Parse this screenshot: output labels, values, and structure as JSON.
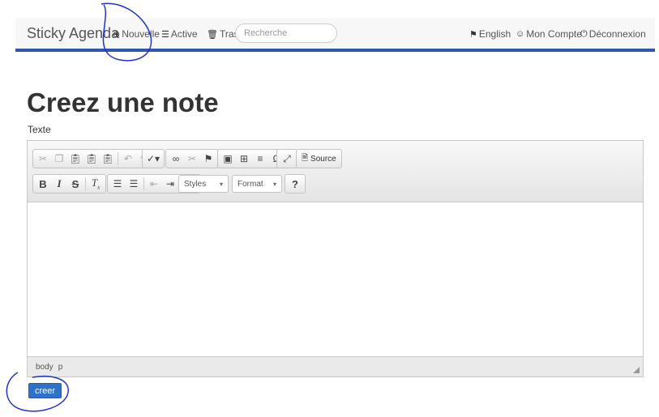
{
  "nav": {
    "brand": "Sticky Agenda",
    "new_label": "Nouvelle",
    "active_label": "Active",
    "trash_label": "Trash",
    "search_placeholder": "Recherche",
    "lang_label": "English",
    "account_label": "Mon Compte",
    "logout_label": "Déconnexion"
  },
  "page": {
    "title": "Creez une note",
    "field_label": "Texte"
  },
  "editor": {
    "source_label": "Source",
    "styles_label": "Styles",
    "format_label": "Format",
    "help_label": "?",
    "status_path": [
      "body",
      "p"
    ]
  },
  "form": {
    "submit_label": "creer"
  },
  "colors": {
    "navbar_border": "#2a58b3",
    "submit_bg": "#2e73c9",
    "annotation": "#1f35c8"
  }
}
